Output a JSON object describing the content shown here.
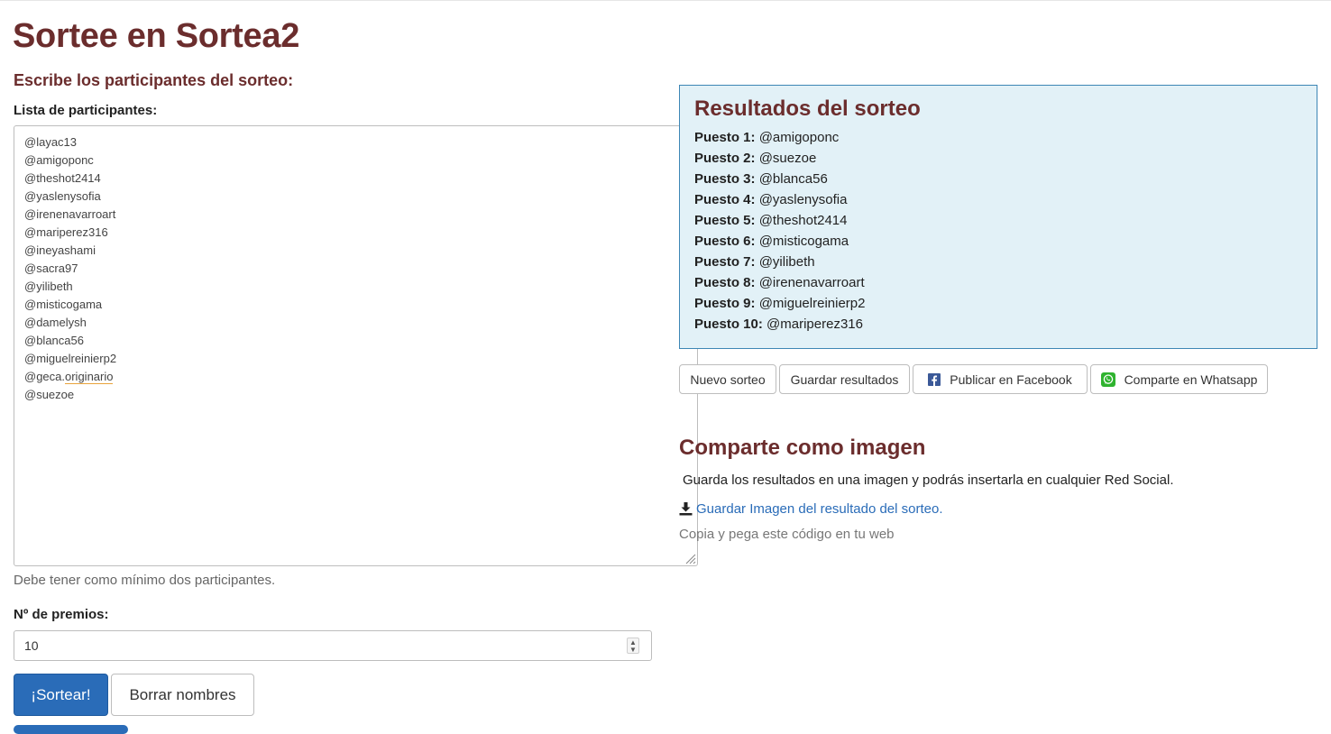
{
  "header": {
    "title": "Sortee en Sortea2",
    "instructions": "Escribe los participantes del sorteo:"
  },
  "form": {
    "list_label": "Lista de participantes:",
    "participants": [
      "@layac13",
      "@amigoponc",
      "@theshot2414",
      "@yaslenysofia",
      "@irenenavarroart",
      "@mariperez316",
      "@ineyashami",
      "@sacra97",
      "@yilibeth",
      "@misticogama",
      "@damelysh",
      "@blanca56",
      "@miguelreinierp2"
    ],
    "participant_spell_prefix": "@geca.",
    "participant_spell_word": "originario",
    "participant_last": "@suezoe",
    "min_hint": "Debe tener como mínimo dos participantes.",
    "prizes_label": "Nº de premios:",
    "prizes_value": "10",
    "draw_label": "¡Sortear!",
    "clear_label": "Borrar nombres"
  },
  "results": {
    "title": "Resultados del sorteo",
    "rows": [
      {
        "position": "Puesto 1:",
        "name": "@amigoponc"
      },
      {
        "position": "Puesto 2:",
        "name": "@suezoe"
      },
      {
        "position": "Puesto 3:",
        "name": "@blanca56"
      },
      {
        "position": "Puesto 4:",
        "name": "@yaslenysofia"
      },
      {
        "position": "Puesto 5:",
        "name": "@theshot2414"
      },
      {
        "position": "Puesto 6:",
        "name": "@misticogama"
      },
      {
        "position": "Puesto 7:",
        "name": "@yilibeth"
      },
      {
        "position": "Puesto 8:",
        "name": "@irenenavarroart"
      },
      {
        "position": "Puesto 9:",
        "name": "@miguelreinierp2"
      },
      {
        "position": "Puesto 10:",
        "name": "@mariperez316"
      }
    ]
  },
  "actions": {
    "new_draw": "Nuevo sorteo",
    "save_results": "Guardar resultados",
    "facebook": "Publicar en Facebook",
    "whatsapp": "Comparte en Whatsapp"
  },
  "share": {
    "title": "Comparte como imagen",
    "text": "Guarda los resultados en una imagen y podrás insertarla en cualquier Red Social.",
    "download_link": "Guardar Imagen del resultado del sorteo.",
    "copy_hint": "Copia y pega este código en tu web"
  },
  "icons": {
    "facebook": "facebook-icon",
    "whatsapp": "whatsapp-icon",
    "download": "download-icon"
  },
  "colors": {
    "heading": "#6b2d2d",
    "primary": "#2a6cb8",
    "results_bg": "#e2f1f7",
    "results_border": "#3d86b5",
    "facebook": "#3b5998",
    "whatsapp": "#2fb32f"
  }
}
